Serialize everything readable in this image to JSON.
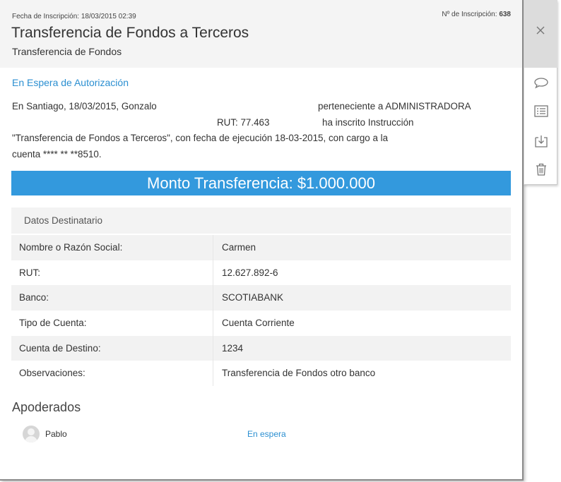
{
  "header": {
    "fecha_label": "Fecha de Inscripción:",
    "fecha_value": "18/03/2015 02:39",
    "num_label": "Nº de Inscripción:",
    "num_value": "638",
    "title": "Transferencia de Fondos a Terceros",
    "subtitle": "Transferencia de Fondos"
  },
  "status": "En Espera de Autorización",
  "description": {
    "l1a": "En Santiago, 18/03/2015, Gonzalo",
    "l1b": "perteneciente a ADMINISTRADORA",
    "l2a": "RUT: 77.463",
    "l2b": "ha inscrito Instrucción",
    "l3": "\"Transferencia de Fondos a Terceros\", con fecha de ejecución 18-03-2015, con cargo a la",
    "l4": "cuenta **** ** **8510."
  },
  "amount": "Monto Transferencia: $1.000.000",
  "destinatario": {
    "heading": "Datos Destinatario",
    "rows": [
      {
        "label": "Nombre o Razón Social:",
        "value": "Carmen"
      },
      {
        "label": "RUT:",
        "value": "12.627.892-6"
      },
      {
        "label": "Banco:",
        "value": "SCOTIABANK"
      },
      {
        "label": "Tipo de Cuenta:",
        "value": "Cuenta Corriente"
      },
      {
        "label": "Cuenta de Destino:",
        "value": "1234"
      },
      {
        "label": "Observaciones:",
        "value": "Transferencia de Fondos otro banco"
      }
    ]
  },
  "apoderados": {
    "title": "Apoderados",
    "items": [
      {
        "name": "Pablo",
        "status": "En espera"
      }
    ]
  },
  "icons": {
    "close": "close-icon",
    "comment": "comment-icon",
    "list": "list-icon",
    "download": "download-icon",
    "delete": "trash-icon"
  },
  "colors": {
    "accent": "#3399dd",
    "link": "#2b8fd1",
    "header_bg": "#f4f4f4",
    "row_alt": "#f2f2f2"
  }
}
